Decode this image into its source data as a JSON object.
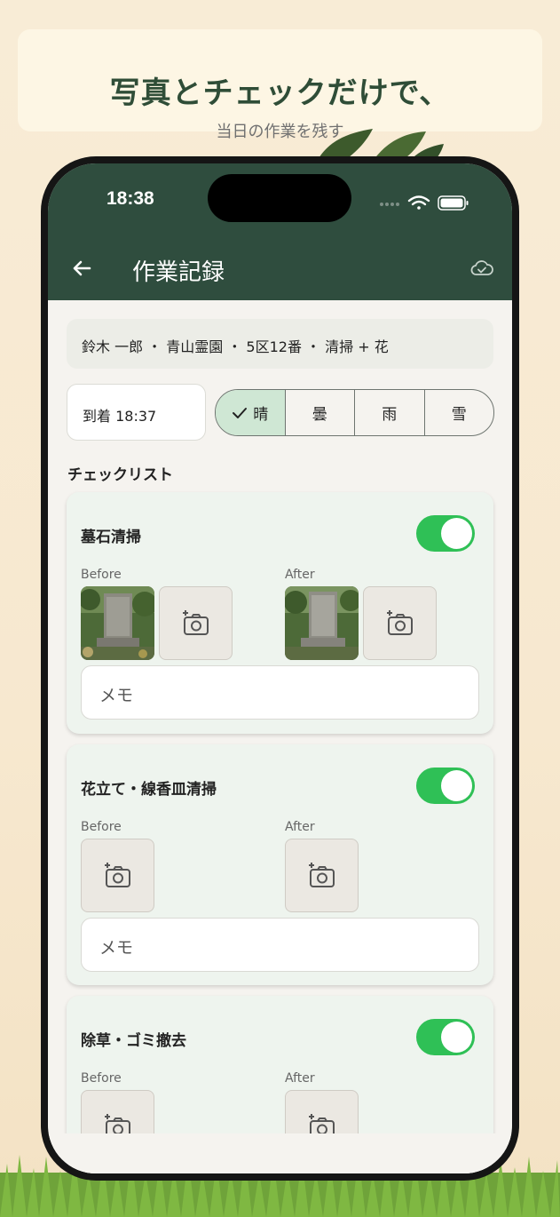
{
  "promo": {
    "headline": "写真とチェックだけで、",
    "subheadline": "当日の作業を残す"
  },
  "status_bar": {
    "time": "18:38"
  },
  "app_bar": {
    "title": "作業記録",
    "back_icon": "arrow-left-icon",
    "sync_icon": "cloud-check-icon"
  },
  "job_info": "鈴木 一郎 ・ 青山霊園 ・ 5区12番 ・ 清掃 + 花",
  "arrival": "到着 18:37",
  "weather": {
    "options": [
      "晴",
      "曇",
      "雨",
      "雪"
    ],
    "selected": "晴"
  },
  "checklist_label": "チェックリスト",
  "checklist": [
    {
      "title": "墓石清掃",
      "enabled": true,
      "before_label": "Before",
      "after_label": "After",
      "has_before_photo": true,
      "has_after_photo": true,
      "memo_placeholder": "メモ"
    },
    {
      "title": "花立て・線香皿清掃",
      "enabled": true,
      "before_label": "Before",
      "after_label": "After",
      "has_before_photo": false,
      "has_after_photo": false,
      "memo_placeholder": "メモ"
    },
    {
      "title": "除草・ゴミ撤去",
      "enabled": true,
      "before_label": "Before",
      "after_label": "After",
      "has_before_photo": false,
      "has_after_photo": false,
      "memo_placeholder": "メモ"
    }
  ],
  "colors": {
    "app_bar": "#2f4d3e",
    "toggle_on": "#2fc056",
    "card_bg": "#eef4ee",
    "selected_segment": "#cfe7d4"
  }
}
